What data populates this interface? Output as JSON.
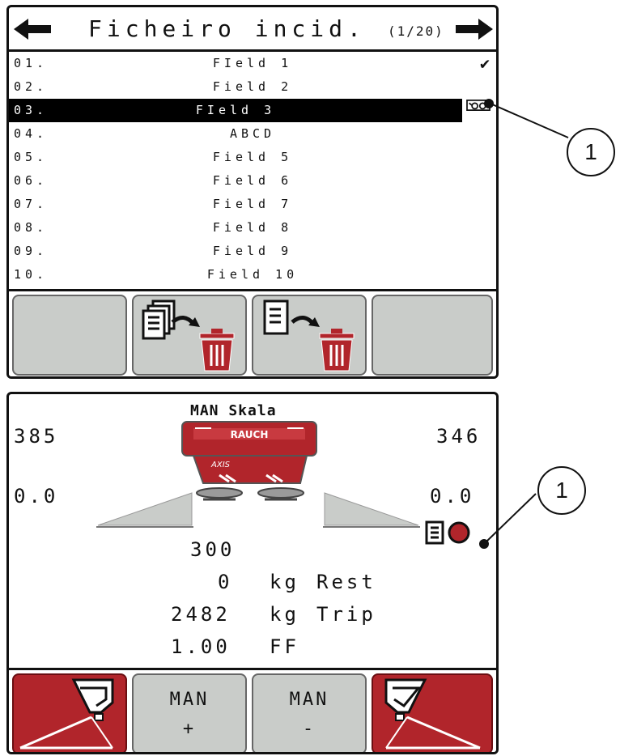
{
  "file_list_screen": {
    "title": "Ficheiro incid.",
    "page_indicator": "(1/20)",
    "rows": [
      {
        "num": "01.",
        "name": "FIeld 1",
        "marker": "✔"
      },
      {
        "num": "02.",
        "name": "Field 2",
        "marker": ""
      },
      {
        "num": "03.",
        "name": "FIeld 3",
        "marker": "glasses-icon",
        "selected": true
      },
      {
        "num": "04.",
        "name": "ABCD",
        "marker": ""
      },
      {
        "num": "05.",
        "name": "Field 5",
        "marker": ""
      },
      {
        "num": "06.",
        "name": "Field 6",
        "marker": ""
      },
      {
        "num": "07.",
        "name": "Field 7",
        "marker": ""
      },
      {
        "num": "08.",
        "name": "Field 8",
        "marker": ""
      },
      {
        "num": "09.",
        "name": "Field 9",
        "marker": ""
      },
      {
        "num": "10.",
        "name": "Field 10",
        "marker": ""
      }
    ],
    "buttons": [
      "empty",
      "delete-all-files-icon",
      "delete-file-icon",
      "empty"
    ]
  },
  "operating_screen": {
    "mode_title": "MAN Skala",
    "left_value": "385",
    "right_value": "346",
    "left_rate": "0.0",
    "right_rate": "0.0",
    "scale_value": "300",
    "rest_amount": "0",
    "rest_unit": "kg",
    "rest_label": "Rest",
    "trip_amount": "2482",
    "trip_unit": "kg",
    "trip_label": "Trip",
    "flow_factor": "1.00",
    "flow_factor_label": "FF",
    "brand": "RAUCH",
    "buttons": {
      "man_plus_line1": "MAN",
      "man_plus_line2": "+",
      "man_minus_line1": "MAN",
      "man_minus_line2": "-"
    },
    "recording_icon": "field-record-icon"
  },
  "callouts": {
    "top": "1",
    "bottom": "1"
  },
  "colors": {
    "selection": "#000000",
    "button_grey": "#c9ccc9",
    "button_red": "#b1252b"
  }
}
